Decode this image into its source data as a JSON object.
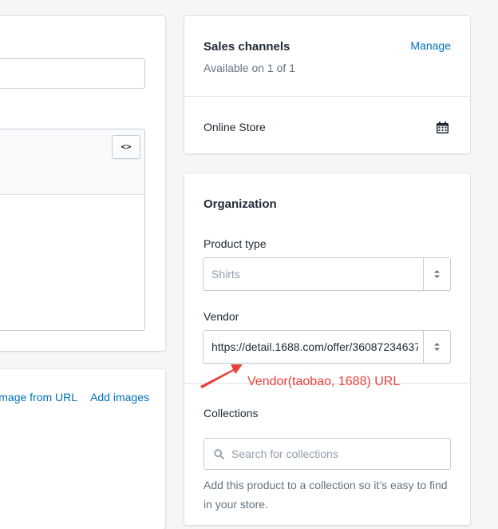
{
  "description_editor": {
    "code_toggle_label": "<>"
  },
  "media": {
    "add_from_url_label": "mage from URL",
    "add_images_label": "Add images"
  },
  "sales_channels": {
    "title": "Sales channels",
    "subtitle": "Available on 1 of 1",
    "manage_label": "Manage",
    "channels": [
      {
        "name": "Online Store",
        "icon": "calendar-icon"
      }
    ]
  },
  "organization": {
    "title": "Organization",
    "product_type": {
      "label": "Product type",
      "value": "Shirts"
    },
    "vendor": {
      "label": "Vendor",
      "value": "https://detail.1688.com/offer/36087234637"
    },
    "collections": {
      "label": "Collections",
      "placeholder": "Search for collections",
      "help_text": "Add this product to a collection so it’s easy to find in your store."
    }
  },
  "annotation": {
    "text": "Vendor(taobao, 1688) URL",
    "color": "#e8413d"
  }
}
